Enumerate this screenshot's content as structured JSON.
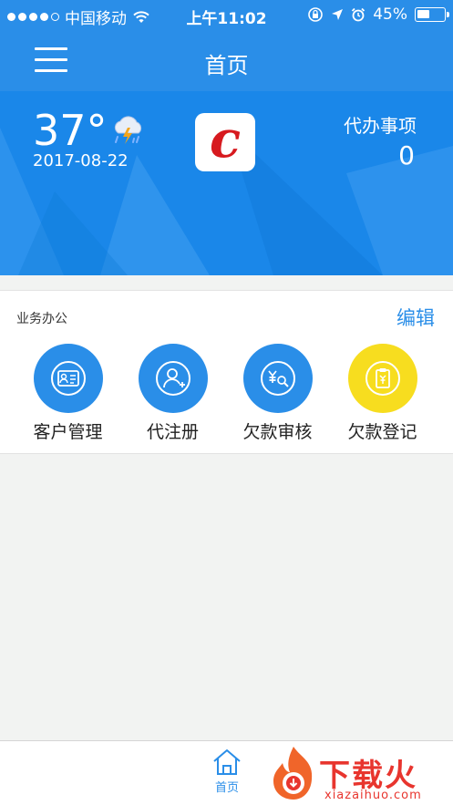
{
  "status_bar": {
    "carrier": "中国移动",
    "time": "上午11:02",
    "battery": "45%",
    "battery_level": 0.45,
    "signal_bars": 4,
    "signal_max": 5,
    "icons": [
      "wifi-icon",
      "lock-rotation-icon",
      "location-arrow-icon",
      "alarm-icon",
      "battery-icon"
    ]
  },
  "navbar": {
    "title": "首页",
    "menu_icon": "hamburger-menu-icon"
  },
  "hero": {
    "temperature": "37°",
    "date": "2017-08-22",
    "weather_icon": "thunderstorm-icon",
    "logo_letter": "c",
    "todo_label": "代办事项",
    "todo_count": "0",
    "colors": {
      "background": "#1a87e9",
      "logo_red": "#d71a1f"
    }
  },
  "office": {
    "title": "业务办公",
    "edit_label": "编辑",
    "items": [
      {
        "label": "客户管理",
        "icon": "customer-card-icon",
        "color": "#2a8ee8"
      },
      {
        "label": "代注册",
        "icon": "add-user-icon",
        "color": "#2a8ee8"
      },
      {
        "label": "欠款审核",
        "icon": "yuan-search-icon",
        "color": "#2a8ee8"
      },
      {
        "label": "欠款登记",
        "icon": "clipboard-yuan-icon",
        "color": "#f7dd1f"
      }
    ]
  },
  "tabbar": {
    "home_label": "首页",
    "home_icon": "home-icon"
  },
  "watermark": {
    "text": "下载火",
    "url": "xiazaihuo.com"
  },
  "colors": {
    "accent": "#2a8ee8",
    "page_bg": "#f2f3f2"
  }
}
